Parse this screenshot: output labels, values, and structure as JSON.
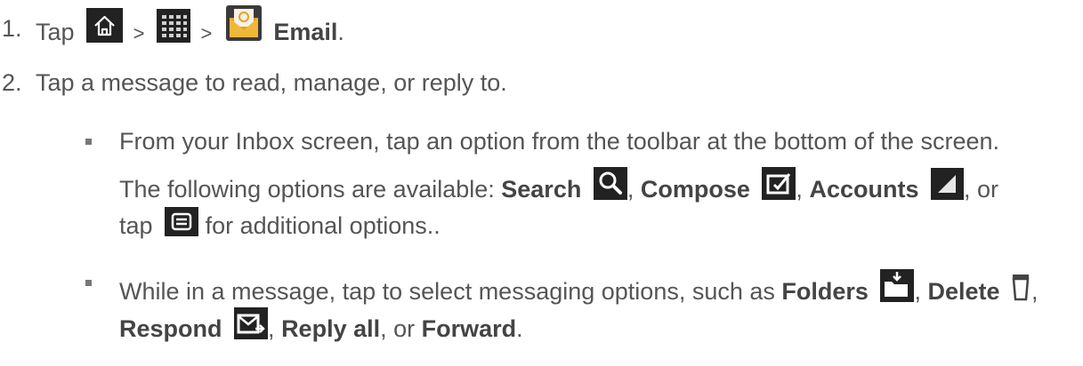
{
  "step1": {
    "number": "1.",
    "tap": "Tap",
    "sep1": ">",
    "sep2": ">",
    "email": "Email",
    "period": ".",
    "icons": [
      "home-icon",
      "apps-icon",
      "email-app-icon"
    ]
  },
  "step2": {
    "number": "2.",
    "text": "Tap a message to read, manage, or reply to."
  },
  "bullet1": {
    "line1": "From your Inbox screen, tap an option from the toolbar at the bottom of the screen.",
    "line2_prefix": "The following options are available: ",
    "search": "Search",
    "comma1": ",",
    "compose": "Compose",
    "comma2": ",",
    "accounts": "Accounts",
    "or": ", or",
    "tap": "tap",
    "suffix": "for additional options..",
    "icons": [
      "search-icon",
      "compose-icon",
      "accounts-icon",
      "menu-icon"
    ]
  },
  "bullet2": {
    "prefix": "While in a message, tap to select messaging options, such as ",
    "folders": "Folders",
    "comma1": ",",
    "delete": "Delete",
    "comma2": ",",
    "respond": "Respond",
    "comma3": ",",
    "reply_all": "Reply all",
    "or": ", or",
    "forward": "Forward",
    "period": ".",
    "icons": [
      "folder-icon",
      "trash-icon",
      "respond-icon"
    ]
  },
  "colors": {
    "text": "#555555",
    "bold": "#444444",
    "icon_bg": "#222222",
    "email_icon_accent": "#e8a020"
  }
}
